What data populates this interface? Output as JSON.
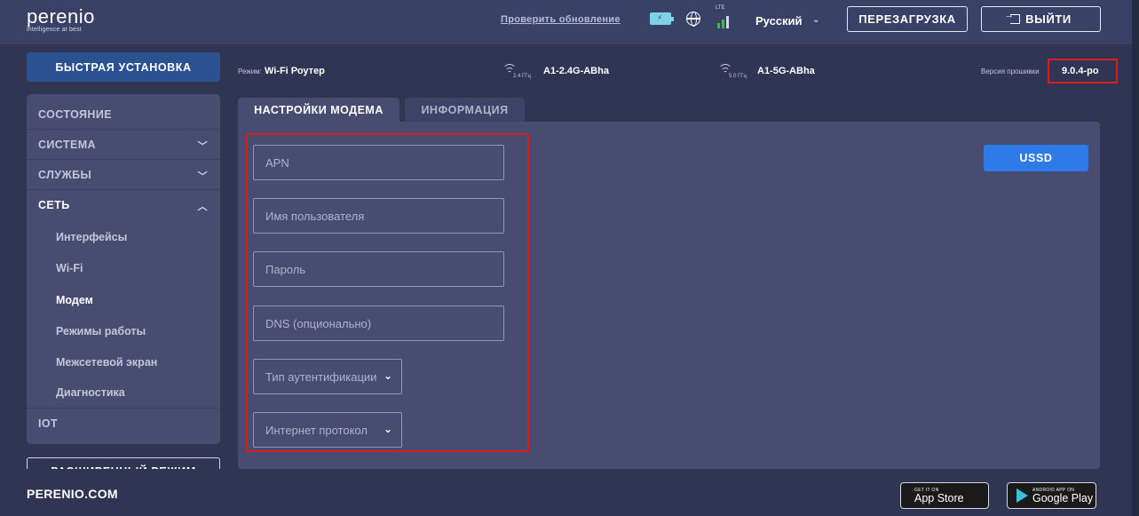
{
  "header": {
    "logo_text": "perenio",
    "logo_tagline": "intelligence at best",
    "check_update": "Проверить обновление",
    "lte_label": "LTE",
    "language": "Русский",
    "reboot_label": "ПЕРЕЗАГРУЗКА",
    "logout_label": "ВЫЙТИ"
  },
  "sidebar": {
    "quick_setup": "БЫСТРАЯ УСТАНОВКА",
    "items": [
      {
        "label": "СОСТОЯНИЕ"
      },
      {
        "label": "СИСТЕМА"
      },
      {
        "label": "СЛУЖБЫ"
      },
      {
        "label": "СЕТЬ"
      }
    ],
    "network_sub": [
      {
        "label": "Интерфейсы"
      },
      {
        "label": "Wi-Fi"
      },
      {
        "label": "Модем"
      },
      {
        "label": "Режимы работы"
      },
      {
        "label": "Межсетевой экран"
      },
      {
        "label": "Диагностика"
      }
    ],
    "iot": "IOT",
    "advanced_mode": "РАСШИРЕННЫЙ РЕЖИМ"
  },
  "status": {
    "mode_label": "Режим:",
    "mode_value": "Wi-Fi Роутер",
    "wifi24_band": "2.4 ГГц",
    "wifi24_ssid": "A1-2.4G-ABha",
    "wifi5_band": "5.0 ГГц",
    "wifi5_ssid": "A1-5G-ABha",
    "firmware_label": "Версия прошивки",
    "firmware_version": "9.0.4-po"
  },
  "tabs": [
    {
      "label": "НАСТРОЙКИ МОДЕМА",
      "active": true
    },
    {
      "label": "ИНФОРМАЦИЯ",
      "active": false
    }
  ],
  "form": {
    "apn_placeholder": "APN",
    "username_placeholder": "Имя пользователя",
    "password_placeholder": "Пароль",
    "dns_placeholder": "DNS (опционально)",
    "auth_type": "Тип аутентификации",
    "internet_protocol": "Интернет протокол",
    "ussd_label": "USSD"
  },
  "footer": {
    "site": "PERENIO.COM",
    "app_store_sub": "GET IT ON",
    "app_store_main": "App Store",
    "google_play_sub": "ANDROID APP ON",
    "google_play_main": "Google Play"
  },
  "colors": {
    "background": "#2f3553",
    "header": "#394166",
    "panel": "#474c70",
    "accent_blue": "#2e7ae8",
    "quick_setup": "#2b5191",
    "highlight_red": "#d41f1f"
  }
}
